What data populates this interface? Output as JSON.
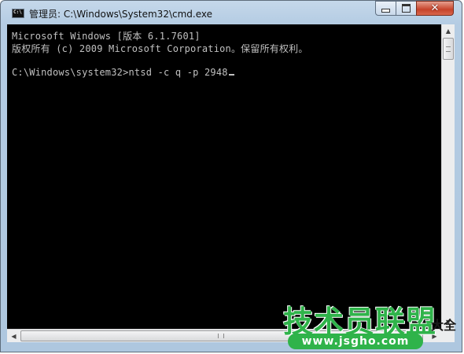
{
  "window": {
    "title": "管理员: C:\\Windows\\System32\\cmd.exe",
    "icon": "cmd-icon",
    "controls": {
      "minimize_icon": "minimize-icon",
      "maximize_icon": "maximize-icon",
      "close_glyph": "✕"
    }
  },
  "console": {
    "lines": [
      "Microsoft Windows [版本 6.1.7601]",
      "版权所有 (c) 2009 Microsoft Corporation。保留所有权利。",
      "",
      "C:\\Windows\\system32>ntsd -c q -p 2948"
    ],
    "colors": {
      "background": "#000000",
      "text": "#c0c0c0"
    }
  },
  "scrollbars": {
    "up_arrow": "▲",
    "down_arrow": "▼",
    "left_arrow": "◀",
    "right_arrow": "▶"
  },
  "watermark": {
    "main": "技术员联盟",
    "side": "大全",
    "url": "www.jsgho.com",
    "color": "#2fb34a"
  }
}
